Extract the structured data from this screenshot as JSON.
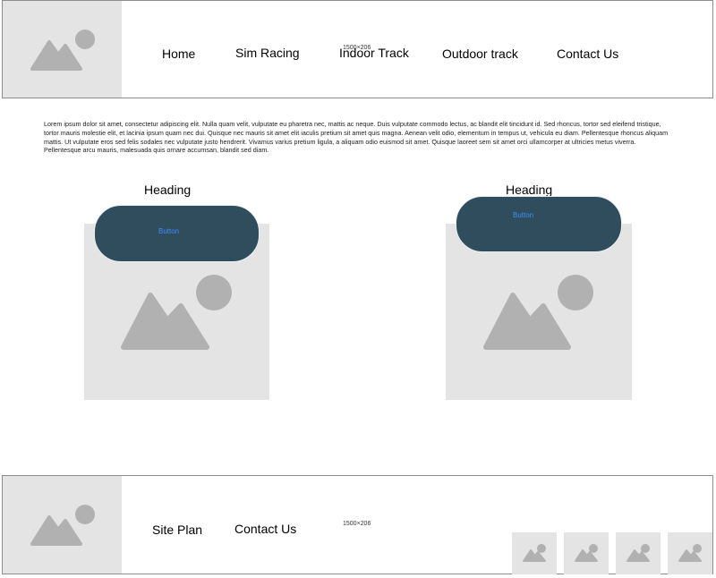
{
  "header": {
    "logo_icon": "image-placeholder-icon",
    "banner_label": "1500×206",
    "nav": [
      {
        "label": "Home"
      },
      {
        "label": "Sim Racing"
      },
      {
        "label": "Indoor Track"
      },
      {
        "label": "Outdoor track"
      },
      {
        "label": "Contact Us"
      }
    ]
  },
  "main": {
    "paragraph": "Lorem ipsum dolor sit amet, consectetur adipiscing elit. Nulla quam velit, vulputate eu pharetra nec, mattis ac neque. Duis vulputate commodo lectus, ac blandit elit tincidunt id. Sed rhoncus, tortor sed eleifend tristique, tortor mauris molestie elit, et lacinia ipsum quam nec dui. Quisque nec mauris sit amet elit iaculis pretium sit amet quis magna. Aenean velit odio, elementum in tempus ut, vehicula eu diam. Pellentesque rhoncus aliquam mattis. Ut vulputate eros sed felis sodales nec vulputate justo hendrerit. Vivamus varius pretium ligula, a aliquam odio euismod sit amet. Quisque laoreet sem sit amet orci ullamcorper at ultricies metus viverra. Pellentesque arcu mauris, malesuada quis ornare accumsan, blandit sed diam.",
    "cards": [
      {
        "heading": "Heading",
        "button_label": "Button",
        "image_icon": "image-placeholder-icon"
      },
      {
        "heading": "Heading",
        "button_label": "Button",
        "image_icon": "image-placeholder-icon"
      }
    ]
  },
  "footer": {
    "logo_icon": "image-placeholder-icon",
    "banner_label": "1500×206",
    "links": [
      {
        "label": "Site Plan"
      },
      {
        "label": "Contact Us"
      }
    ],
    "thumbnails": [
      {
        "icon": "image-placeholder-icon"
      },
      {
        "icon": "image-placeholder-icon"
      },
      {
        "icon": "image-placeholder-icon"
      },
      {
        "icon": "image-placeholder-icon"
      }
    ]
  },
  "colors": {
    "button_fill": "#2f4d5c",
    "button_text": "#3e8cff",
    "placeholder_bg": "#e4e4e4",
    "placeholder_shape": "#b1b1b1",
    "border": "#8d8d8d"
  }
}
